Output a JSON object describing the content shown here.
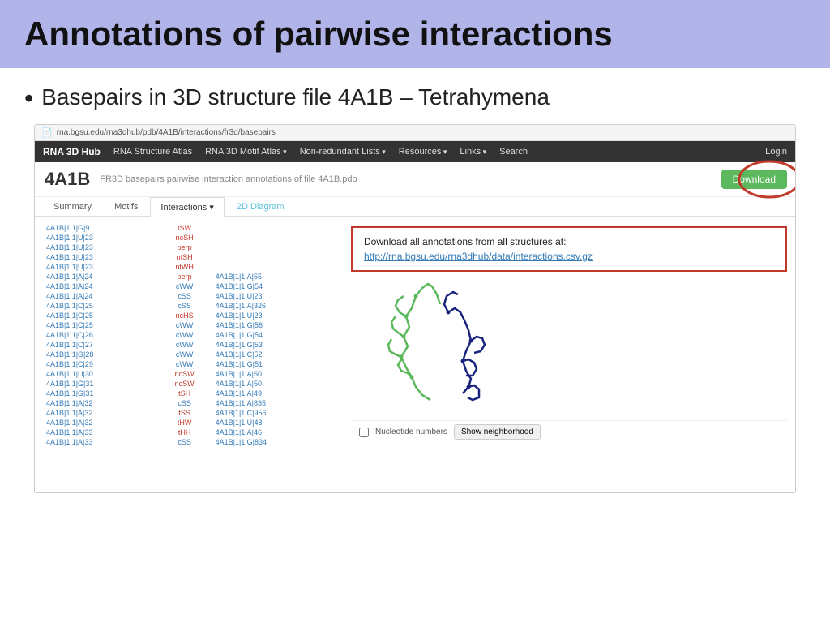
{
  "header": {
    "title": "Annotations of pairwise interactions"
  },
  "bullet": {
    "text": "Basepairs in 3D structure file 4A1B – Tetrahymena"
  },
  "browser": {
    "address": "rna.bgsu.edu/rna3dhub/pdb/4A1B/interactions/fr3d/basepairs",
    "page_icon": "📄"
  },
  "navbar": {
    "brand": "RNA 3D Hub",
    "items": [
      {
        "label": "RNA Structure Atlas",
        "dropdown": false
      },
      {
        "label": "RNA 3D Motif Atlas",
        "dropdown": true
      },
      {
        "label": "Non-redundant Lists",
        "dropdown": true
      },
      {
        "label": "Resources",
        "dropdown": true
      },
      {
        "label": "Links",
        "dropdown": true
      },
      {
        "label": "Search",
        "dropdown": false
      },
      {
        "label": "Login",
        "dropdown": false
      }
    ]
  },
  "page_header": {
    "pdb_id": "4A1B",
    "description": "FR3D basepairs pairwise interaction annotations of file 4A1B.pdb",
    "download_label": "Download"
  },
  "tabs": [
    {
      "label": "Summary",
      "active": false
    },
    {
      "label": "Motifs",
      "active": false
    },
    {
      "label": "Interactions",
      "active": true,
      "dropdown": true
    },
    {
      "label": "2D Diagram",
      "active": false,
      "highlight": true
    }
  ],
  "annotation_box": {
    "text": "Download all annotations from all structures at:",
    "link_text": "http://rna.bgsu.edu/rna3dhub/data/interactions.csv.gz",
    "link_url": "http://rna.bgsu.edu/rna3dhub/data/interactions.csv.gz"
  },
  "table": {
    "rows": [
      {
        "col1": "4A1B|1|1|G|9",
        "col2": "tSW",
        "col3": ""
      },
      {
        "col1": "4A1B|1|1|U|23",
        "col2": "ncSH",
        "col3": ""
      },
      {
        "col1": "4A1B|1|1|U|23",
        "col2": "perp",
        "col3": ""
      },
      {
        "col1": "4A1B|1|1|U|23",
        "col2": "ntSH",
        "col3": ""
      },
      {
        "col1": "4A1B|1|1|U|23",
        "col2": "ntWH",
        "col3": ""
      },
      {
        "col1": "4A1B|1|1|A|24",
        "col2": "perp",
        "col3": "4A1B|1|1|A|55"
      },
      {
        "col1": "4A1B|1|1|A|24",
        "col2": "cWW",
        "col3": "4A1B|1|1|G|54"
      },
      {
        "col1": "4A1B|1|1|A|24",
        "col2": "cSS",
        "col3": "4A1B|1|1|U|23"
      },
      {
        "col1": "4A1B|1|1|C|25",
        "col2": "cSS",
        "col3": "4A1B|1|1|A|326"
      },
      {
        "col1": "4A1B|1|1|C|25",
        "col2": "ncHS",
        "col3": "4A1B|1|1|U|23"
      },
      {
        "col1": "4A1B|1|1|C|25",
        "col2": "cWW",
        "col3": "4A1B|1|1|G|56"
      },
      {
        "col1": "4A1B|1|1|C|26",
        "col2": "cWW",
        "col3": "4A1B|1|1|G|54"
      },
      {
        "col1": "4A1B|1|1|C|27",
        "col2": "cWW",
        "col3": "4A1B|1|1|G|53"
      },
      {
        "col1": "4A1B|1|1|G|28",
        "col2": "cWW",
        "col3": "4A1B|1|1|C|52"
      },
      {
        "col1": "4A1B|1|1|C|29",
        "col2": "cWW",
        "col3": "4A1B|1|1|G|51"
      },
      {
        "col1": "4A1B|1|1|U|30",
        "col2": "ncSW",
        "col3": "4A1B|1|1|A|50"
      },
      {
        "col1": "4A1B|1|1|G|31",
        "col2": "ncSW",
        "col3": "4A1B|1|1|A|50"
      },
      {
        "col1": "4A1B|1|1|G|31",
        "col2": "tSH",
        "col3": "4A1B|1|1|A|49"
      },
      {
        "col1": "4A1B|1|1|A|32",
        "col2": "cSS",
        "col3": "4A1B|1|1|A|835"
      },
      {
        "col1": "4A1B|1|1|A|32",
        "col2": "tSS",
        "col3": "4A1B|1|1|C|956"
      },
      {
        "col1": "4A1B|1|1|A|32",
        "col2": "tHW",
        "col3": "4A1B|1|1|U|48"
      },
      {
        "col1": "4A1B|1|1|A|33",
        "col2": "tHH",
        "col3": "4A1B|1|1|A|46"
      },
      {
        "col1": "4A1B|1|1|A|33",
        "col2": "cSS",
        "col3": "4A1B|1|1|G|834"
      }
    ]
  },
  "nucleotide_controls": {
    "checkbox_label": "Nucleotide numbers",
    "button_label": "Show neighborhood"
  },
  "colors": {
    "header_bg": "#b0b4e8",
    "navbar_bg": "#333333",
    "download_btn": "#5cb85c",
    "annotation_border": "#c0392b",
    "link_color": "#337ab7"
  }
}
